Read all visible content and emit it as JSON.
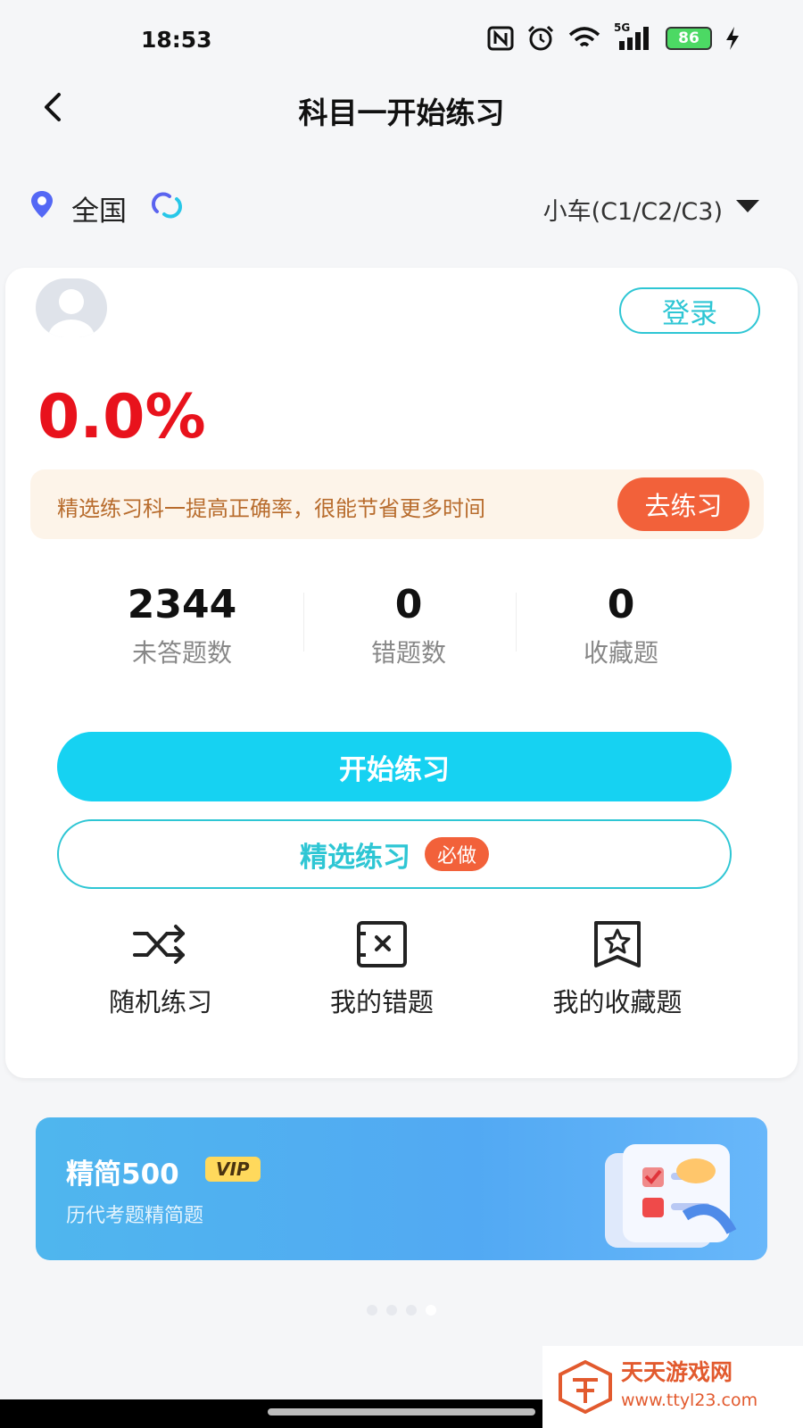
{
  "status_bar": {
    "time": "18:53",
    "signal": "5G",
    "battery": "86"
  },
  "header": {
    "title": "科目一开始练习"
  },
  "location": {
    "region": "全国",
    "car_type": "小车(C1/C2/C3)"
  },
  "card": {
    "login_label": "登录",
    "accuracy": "0.0%",
    "tip": {
      "text": "精选练习科一提高正确率，很能节省更多时间",
      "button": "去练习"
    },
    "stats": [
      {
        "value": "2344",
        "label": "未答题数"
      },
      {
        "value": "0",
        "label": "错题数"
      },
      {
        "value": "0",
        "label": "收藏题"
      }
    ],
    "start_button": "开始练习",
    "select_button": {
      "label": "精选练习",
      "badge": "必做"
    },
    "quick_actions": [
      {
        "label": "随机练习",
        "icon": "shuffle-icon"
      },
      {
        "label": "我的错题",
        "icon": "wrong-question-icon"
      },
      {
        "label": "我的收藏题",
        "icon": "favorite-star-icon"
      }
    ]
  },
  "vip_banner": {
    "title": "精简500",
    "badge": "VIP",
    "subtitle": "历代考题精简题"
  },
  "watermark": {
    "title": "天天游戏网",
    "url": "www.ttyl23.com"
  },
  "colors": {
    "accent": "#16d2f2",
    "accent_border": "#2ec6d4",
    "orange": "#f2613a",
    "red": "#e8121c"
  }
}
